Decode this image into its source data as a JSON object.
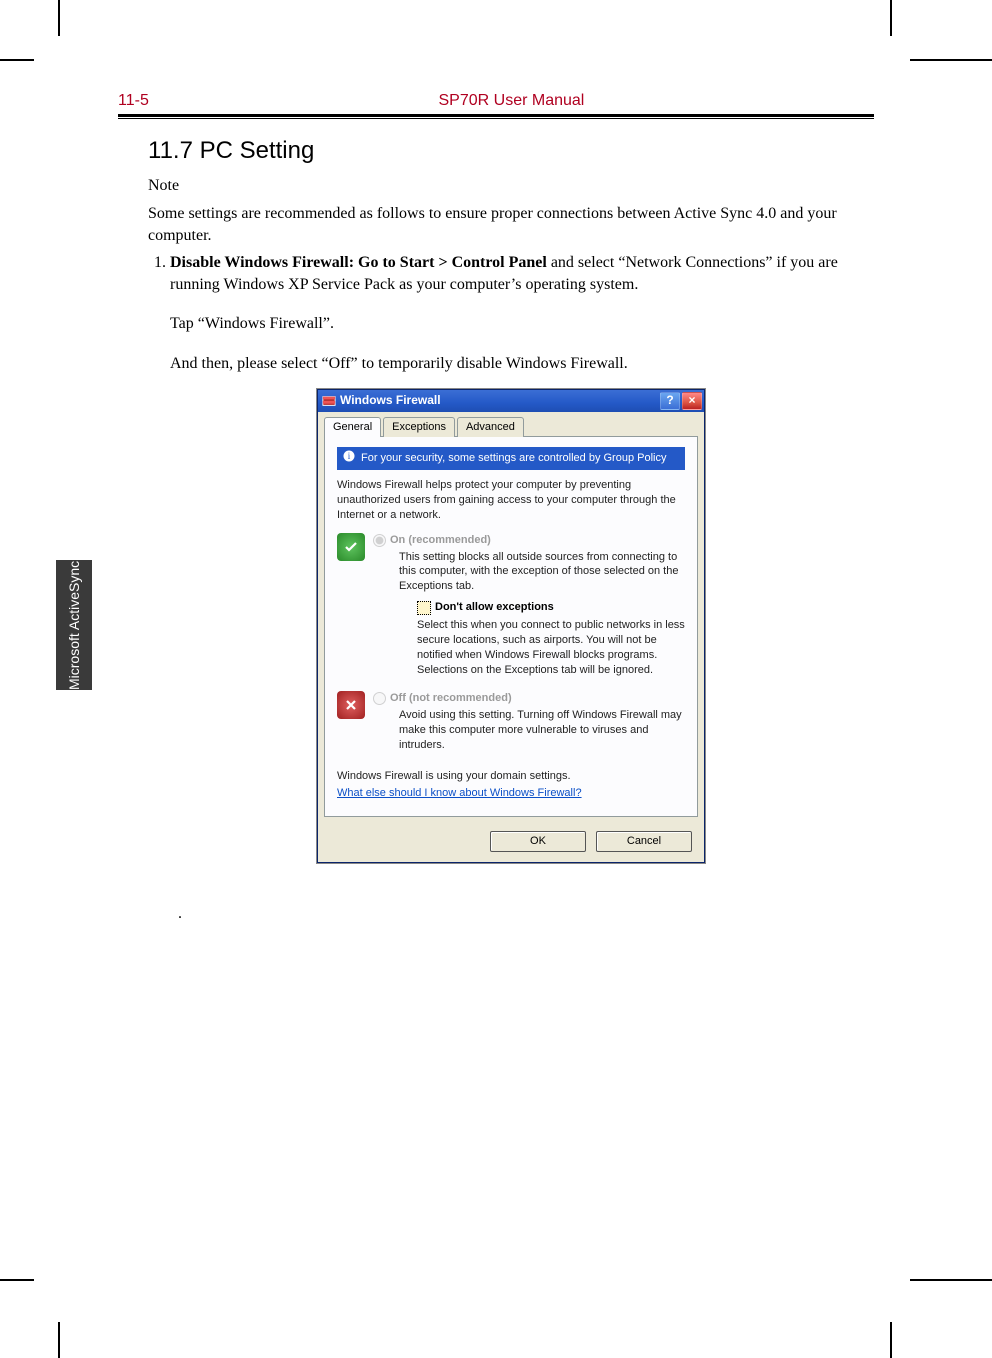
{
  "header": {
    "page_no": "11-5",
    "title": "SP70R User Manual"
  },
  "side_tab": "Microsoft\nActiveSync",
  "section": {
    "heading": "11.7    PC Setting",
    "note_label": "Note"
  },
  "paragraphs": {
    "intro": "Some settings are recommended as follows to ensure proper connections between Active Sync 4.0 and your computer.",
    "li1_bold": "Disable Windows Firewall: Go to Start > Control Panel",
    "li1_rest": " and select “Network Connections” if you are running Windows XP Service Pack as your computer’s operating system.",
    "tap": "Tap “Windows Firewall”.",
    "select_off": "And then, please select “Off” to temporarily disable Windows Firewall.",
    "trailing_dot": "."
  },
  "dialog": {
    "title": "Windows Firewall",
    "help_btn": "?",
    "close_btn": "×",
    "tabs": {
      "general": "General",
      "exceptions": "Exceptions",
      "advanced": "Advanced"
    },
    "banner_icon_name": "info-icon",
    "banner_text": "For your security, some settings are controlled by Group Policy",
    "intro_text": "Windows Firewall helps protect your computer by preventing unauthorized users from gaining access to your computer through the Internet or a network.",
    "on": {
      "label": "On (recommended)",
      "desc": "This setting blocks all outside sources from connecting to this computer, with the exception of those selected on the Exceptions tab."
    },
    "no_exceptions": {
      "label": "Don't allow exceptions",
      "desc": "Select this when you connect to public networks in less secure locations, such as airports. You will not be notified when Windows Firewall blocks programs. Selections on the Exceptions tab will be ignored."
    },
    "off": {
      "label": "Off (not recommended)",
      "desc": "Avoid using this setting. Turning off Windows Firewall may make this computer more vulnerable to viruses and intruders."
    },
    "domain_note": "Windows Firewall is using your domain settings.",
    "help_link": "What else should I know about Windows Firewall?",
    "buttons": {
      "ok": "OK",
      "cancel": "Cancel"
    }
  }
}
